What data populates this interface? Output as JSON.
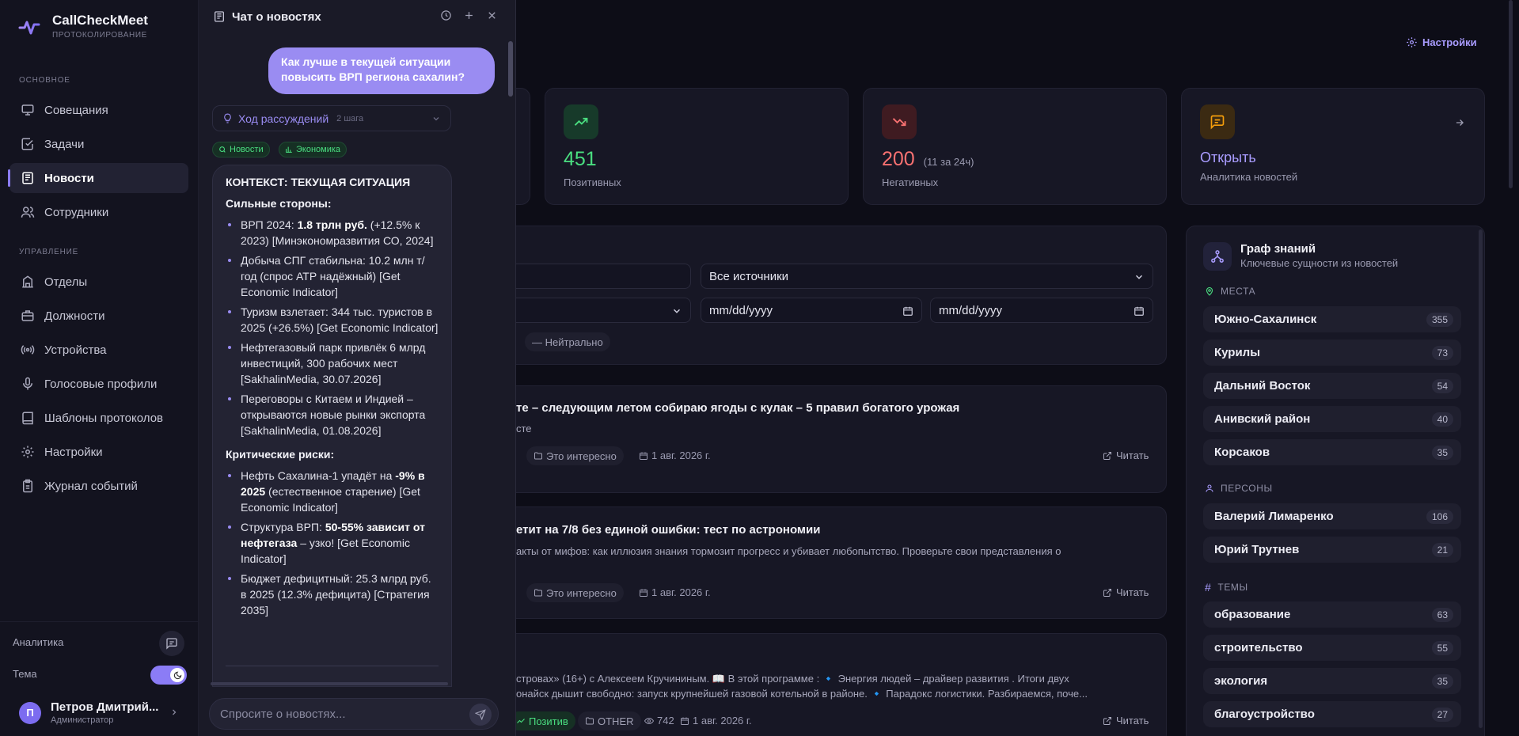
{
  "app": {
    "name": "CallCheckMeet",
    "subtitle": "ПРОТОКОЛИРОВАНИЕ"
  },
  "sidebar": {
    "section_main": "ОСНОВНОЕ",
    "section_manage": "УПРАВЛЕНИЕ",
    "items": [
      {
        "label": "Совещания",
        "icon": "monitor-icon"
      },
      {
        "label": "Задачи",
        "icon": "checkbox-icon"
      },
      {
        "label": "Новости",
        "icon": "newspaper-icon",
        "active": true
      },
      {
        "label": "Сотрудники",
        "icon": "users-icon"
      },
      {
        "label": "Отделы",
        "icon": "building-icon"
      },
      {
        "label": "Должности",
        "icon": "briefcase-icon"
      },
      {
        "label": "Устройства",
        "icon": "radio-icon"
      },
      {
        "label": "Голосовые профили",
        "icon": "mic-icon"
      },
      {
        "label": "Шаблоны протоколов",
        "icon": "template-icon"
      },
      {
        "label": "Настройки",
        "icon": "gear-icon"
      },
      {
        "label": "Журнал событий",
        "icon": "clipboard-icon"
      }
    ],
    "analytics_label": "Аналитика",
    "theme_label": "Тема",
    "user": {
      "initial": "П",
      "name": "Петров Дмитрий...",
      "role": "Администратор"
    }
  },
  "header": {
    "settings_label": "Настройки"
  },
  "stats": [
    {
      "value": "451",
      "label": "Позитивных",
      "color": "#4ade80"
    },
    {
      "value": "200",
      "extra": "(11 за 24ч)",
      "label": "Негативных",
      "color": "#f87171"
    },
    {
      "value": "Открыть",
      "label": "Аналитика новостей",
      "color": "#a99cff"
    }
  ],
  "filters": {
    "sources_value": "Все источники",
    "date_from": "mm/dd/yyyy",
    "date_to": "mm/dd/yyyy",
    "neutral_chip": "— Нейтрально"
  },
  "news": [
    {
      "title": "те – следующим летом собираю ягоды с кулак – 5 правил богатого урожая",
      "sub": "сте",
      "category": "Это интересно",
      "date": "1 авг. 2026 г.",
      "read": "Читать"
    },
    {
      "title": "етит на 7/8 без единой ошибки: тест по астрономии",
      "sub": "акты от мифов: как иллюзия знания тормозит прогресс и убивает любопытство. Проверьте свои представления о",
      "category": "Это интересно",
      "date": "1 авг. 2026 г.",
      "read": "Читать"
    },
    {
      "line1": "строваx» (16+) с Алексеем Кручининым. 📖 В этой программе : 🔹 Энергия людей – драйвер развития . Итоги двух",
      "line2": "онайск дышит свободно: запуск крупнейшей газовой котельной в районе. 🔹 Парадокс логистики. Разбираемся, поче...",
      "sentiment": "Позитив",
      "category": "OTHER",
      "views": "742",
      "date": "1 авг. 2026 г.",
      "read": "Читать"
    }
  ],
  "kg": {
    "title": "Граф знаний",
    "subtitle": "Ключевые сущности из новостей",
    "places_label": "МЕСТА",
    "places": [
      {
        "name": "Южно-Сахалинск",
        "count": "355"
      },
      {
        "name": "Курилы",
        "count": "73"
      },
      {
        "name": "Дальний Восток",
        "count": "54"
      },
      {
        "name": "Анивский район",
        "count": "40"
      },
      {
        "name": "Корсаков",
        "count": "35"
      }
    ],
    "persons_label": "ПЕРСОНЫ",
    "persons": [
      {
        "name": "Валерий Лимаренко",
        "count": "106"
      },
      {
        "name": "Юрий Трутнев",
        "count": "21"
      }
    ],
    "topics_label": "ТЕМЫ",
    "topics": [
      {
        "name": "образование",
        "count": "63"
      },
      {
        "name": "строительство",
        "count": "55"
      },
      {
        "name": "экология",
        "count": "35"
      },
      {
        "name": "благоустройство",
        "count": "27"
      }
    ]
  },
  "chat": {
    "title": "Чат о новостях",
    "user_message": "Как лучше в текущей ситуации повысить ВРП региона сахалин?",
    "reasoning_label": "Ход рассуждений",
    "reasoning_steps": "2 шага",
    "tags": [
      "Новости",
      "Экономика"
    ],
    "context_heading": "КОНТЕКСТ: ТЕКУЩАЯ СИТУАЦИЯ",
    "strengths_heading": "Сильные стороны:",
    "strengths": [
      {
        "pre": "ВРП 2024: ",
        "bold": "1.8 трлн руб.",
        "post": " (+12.5% к 2023) [Минэкономразвития СО, 2024]"
      },
      {
        "pre": "Добыча СПГ стабильна: 10.2 млн т/год (спрос АТР надёжный) [Get Economic Indicator]",
        "bold": "",
        "post": ""
      },
      {
        "pre": "Туризм взлетает: 344 тыс. туристов в 2025 (+26.5%) [Get Economic Indicator]",
        "bold": "",
        "post": ""
      },
      {
        "pre": "Нефтегазовый парк привлёк 6 млрд инвестиций, 300 рабочих мест [SakhalinMedia, 30.07.2026]",
        "bold": "",
        "post": ""
      },
      {
        "pre": "Переговоры с Китаем и Индией – открываются новые рынки экспорта [SakhalinMedia, 01.08.2026]",
        "bold": "",
        "post": ""
      }
    ],
    "risks_heading": "Критические риски:",
    "risks": [
      {
        "pre": "Нефть Сахалина-1 упадёт на ",
        "bold": "-9% в 2025",
        "post": " (естественное старение) [Get Economic Indicator]"
      },
      {
        "pre": "Структура ВРП: ",
        "bold": "50-55% зависит от нефтегаза",
        "post": " – узко! [Get Economic Indicator]"
      },
      {
        "pre": "Бюджет дефицитный: 25.3 млрд руб. в 2025 (12.3% дефицита) [Стратегия 2035]",
        "bold": "",
        "post": ""
      }
    ],
    "input_placeholder": "Спросите о новостях..."
  }
}
